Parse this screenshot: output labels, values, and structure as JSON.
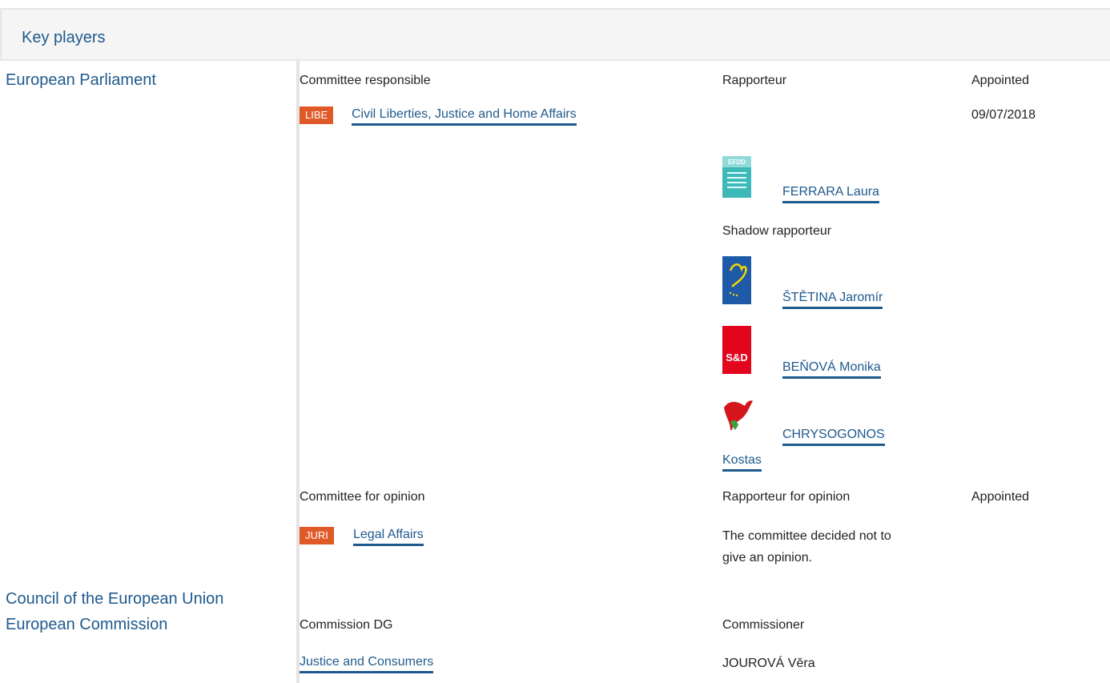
{
  "section": {
    "title": "Key players"
  },
  "actors": {
    "ep": "European Parliament",
    "council": "Council of the European Union",
    "commission": "European Commission"
  },
  "ep_committee": {
    "header_committee": "Committee responsible",
    "header_rapporteur": "Rapporteur",
    "header_appointed": "Appointed",
    "tag": "LIBE",
    "name": "Civil Liberties, Justice and Home Affairs",
    "appointed": "09/07/2018",
    "rapporteur": {
      "name": "FERRARA Laura",
      "group_logo": "efdd-logo",
      "logo_text": "EFDD"
    },
    "shadow_label": "Shadow rapporteur",
    "shadows": [
      {
        "name": "ŠTĚTINA Jaromír",
        "group_logo": "epp-logo"
      },
      {
        "name": "BEŇOVÁ Monika",
        "group_logo": "sd-logo",
        "logo_text": "S&D"
      },
      {
        "name_line1": "CHRYSOGONOS",
        "name_line2": "Kostas",
        "group_logo": "gue-logo"
      }
    ]
  },
  "opinion": {
    "header_committee": "Committee for opinion",
    "header_rapporteur": "Rapporteur for opinion",
    "header_appointed": "Appointed",
    "tag": "JURI",
    "name": "Legal Affairs",
    "note_line1": "The committee decided not to",
    "note_line2": "give an opinion."
  },
  "commission": {
    "header_dg": "Commission DG",
    "header_commissioner": "Commissioner",
    "dg": "Justice and Consumers",
    "commissioner": "JOUROVÁ Věra"
  },
  "colors": {
    "link": "#1f5a8e",
    "tag": "#e05a27",
    "header_bg": "#f5f5f5"
  }
}
